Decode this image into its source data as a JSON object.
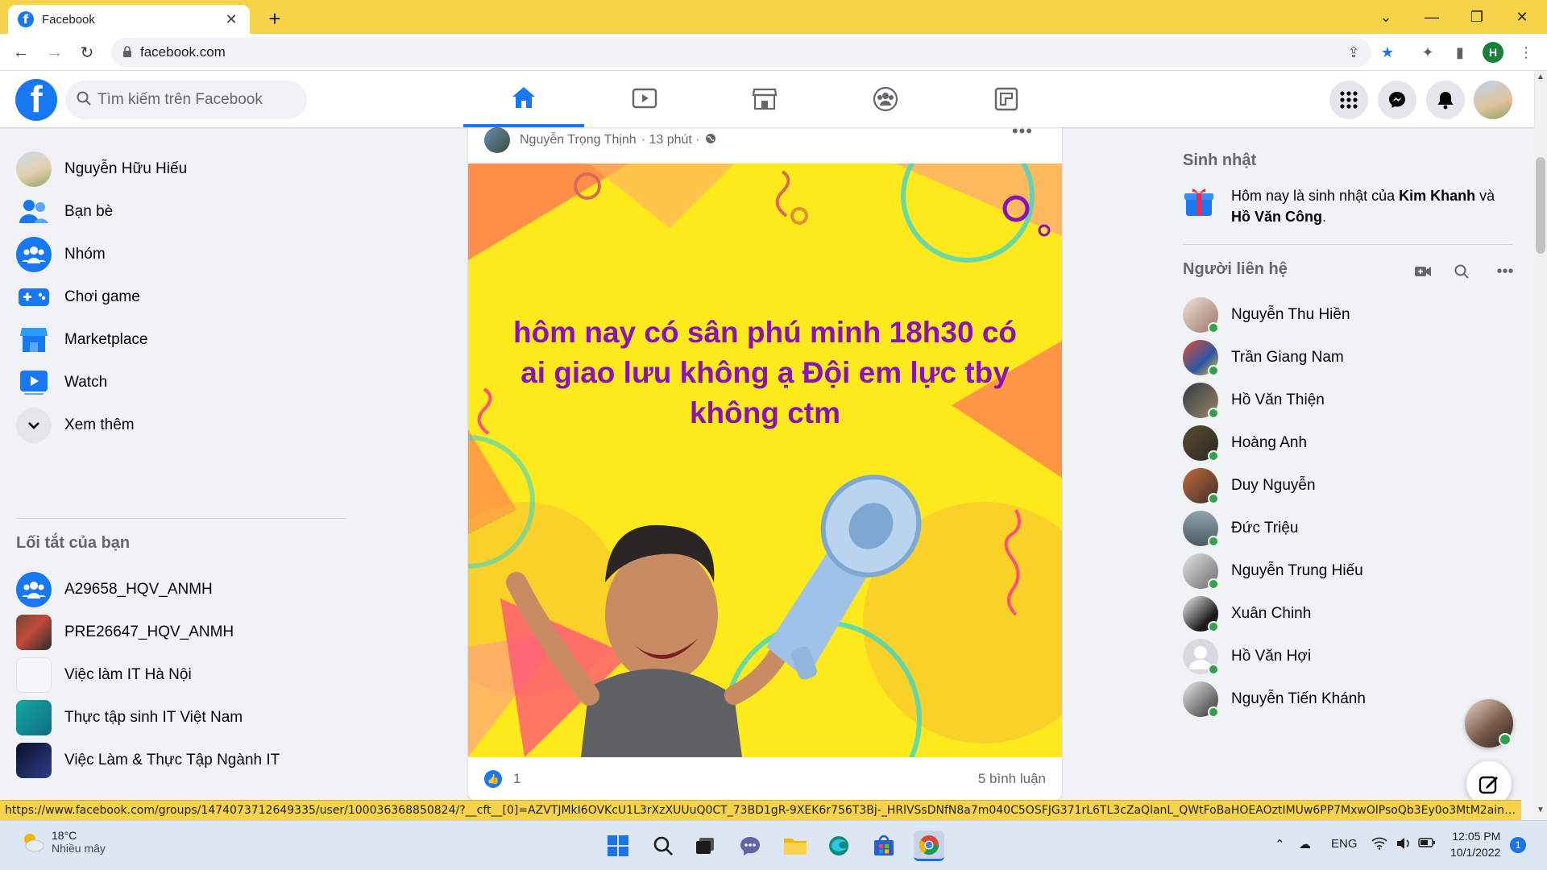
{
  "browser": {
    "tab_title": "Facebook",
    "url": "facebook.com",
    "profile_initial": "H",
    "status_url": "https://www.facebook.com/groups/1474073712649335/user/100036368850824/?__cft__[0]=AZVTJMkI6OVKcU1L3rXzXUUuQ0CT_73BD1gR-9XEK6r756T3Bj-_HRlVSsDNfN8a7m040C5OSFJG371rL6TL3cZaQlanL_QWtFoBaHOEAOztIMUw6PP7MxwOlPsoQb3Ey0o3MtM2ainCAOF7PvAkxJ..."
  },
  "header": {
    "search_placeholder": "Tìm kiếm trên Facebook",
    "logo_letter": "f"
  },
  "left_nav": {
    "items": [
      {
        "label": "Nguyễn Hữu Hiếu"
      },
      {
        "label": "Bạn bè"
      },
      {
        "label": "Nhóm"
      },
      {
        "label": "Chơi game"
      },
      {
        "label": "Marketplace"
      },
      {
        "label": "Watch"
      },
      {
        "label": "Xem thêm"
      }
    ],
    "shortcuts_title": "Lối tắt của bạn",
    "shortcuts": [
      {
        "label": "A29658_HQV_ANMH"
      },
      {
        "label": "PRE26647_HQV_ANMH"
      },
      {
        "label": "Việc làm IT Hà Nội"
      },
      {
        "label": "Thực tập sinh IT Việt Nam"
      },
      {
        "label": "Việc Làm & Thực Tập Ngành IT"
      }
    ]
  },
  "post": {
    "author": "Nguyễn Trọng Thịnh",
    "time": "· 13 phút ·",
    "more": "•••",
    "text": "hôm nay có sân phú minh 18h30 có ai giao lưu không ạ Đội em lực tby không ctm",
    "like_count": "1",
    "comments": "5 bình luận"
  },
  "right_rail": {
    "birthday_title": "Sinh nhật",
    "birthday_prefix": "Hôm nay là sinh nhật của ",
    "birthday_name1": "Kim Khanh",
    "birthday_mid": " và ",
    "birthday_name2": "Hồ Văn Công",
    "birthday_suffix": ".",
    "contacts_title": "Người liên hệ",
    "contacts": [
      {
        "name": "Nguyễn Thu Hiền"
      },
      {
        "name": "Trần Giang Nam"
      },
      {
        "name": "Hồ Văn Thiện"
      },
      {
        "name": "Hoàng Anh"
      },
      {
        "name": "Duy Nguyễn"
      },
      {
        "name": "Đức Triệu"
      },
      {
        "name": "Nguyễn Trung Hiếu"
      },
      {
        "name": "Xuân Chinh"
      },
      {
        "name": "Hồ Văn Hợi"
      },
      {
        "name": "Nguyễn Tiến Khánh"
      }
    ]
  },
  "taskbar": {
    "temperature": "18°C",
    "weather": "Nhiều mây",
    "lang": "ENG",
    "time": "12:05 PM",
    "date": "10/1/2022",
    "notif_count": "1"
  },
  "colors": {
    "fb_blue": "#1877f2",
    "chrome_frame": "#f7d34a",
    "post_bg": "#fde91c",
    "post_text": "#8a12b8",
    "online": "#31a24c"
  }
}
